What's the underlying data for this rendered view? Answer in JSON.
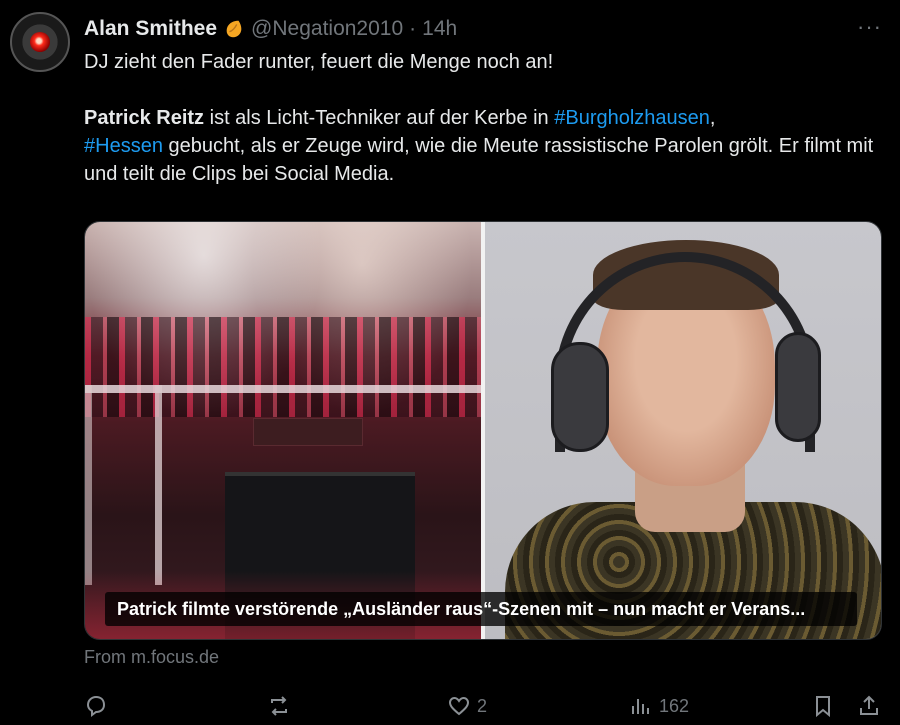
{
  "tweet": {
    "author_name": "Alan Smithee",
    "author_handle": "@Negation2010",
    "separator": "·",
    "time": "14h",
    "more_label": "···",
    "text": {
      "line1": "DJ zieht den Fader runter, feuert die Menge noch an!",
      "bold_name": "Patrick Reitz",
      "part1": " ist als Licht-Techniker auf der Kerbe in ",
      "hashtag1": "#Burgholzhausen",
      "comma": ",",
      "hashtag2": "#Hessen",
      "part2": " gebucht, als er Zeuge wird, wie die Meute rassistische Parolen grölt. Er filmt mit und teilt die Clips bei Social Media."
    },
    "media": {
      "caption": "Patrick filmte verstörende „Ausländer raus“-Szenen mit – nun macht er Verans..."
    },
    "source": "From m.focus.de",
    "actions": {
      "reply_icon": "reply-icon",
      "repost_icon": "repost-icon",
      "like_icon": "heart-icon",
      "like_count": "2",
      "views_icon": "views-icon",
      "views_count": "162",
      "bookmark_icon": "bookmark-icon",
      "share_icon": "share-icon"
    },
    "colors": {
      "background": "#000000",
      "text": "#e7e9ea",
      "muted": "#71767b",
      "link": "#1d9bf0",
      "badge": "#f5a623"
    }
  }
}
